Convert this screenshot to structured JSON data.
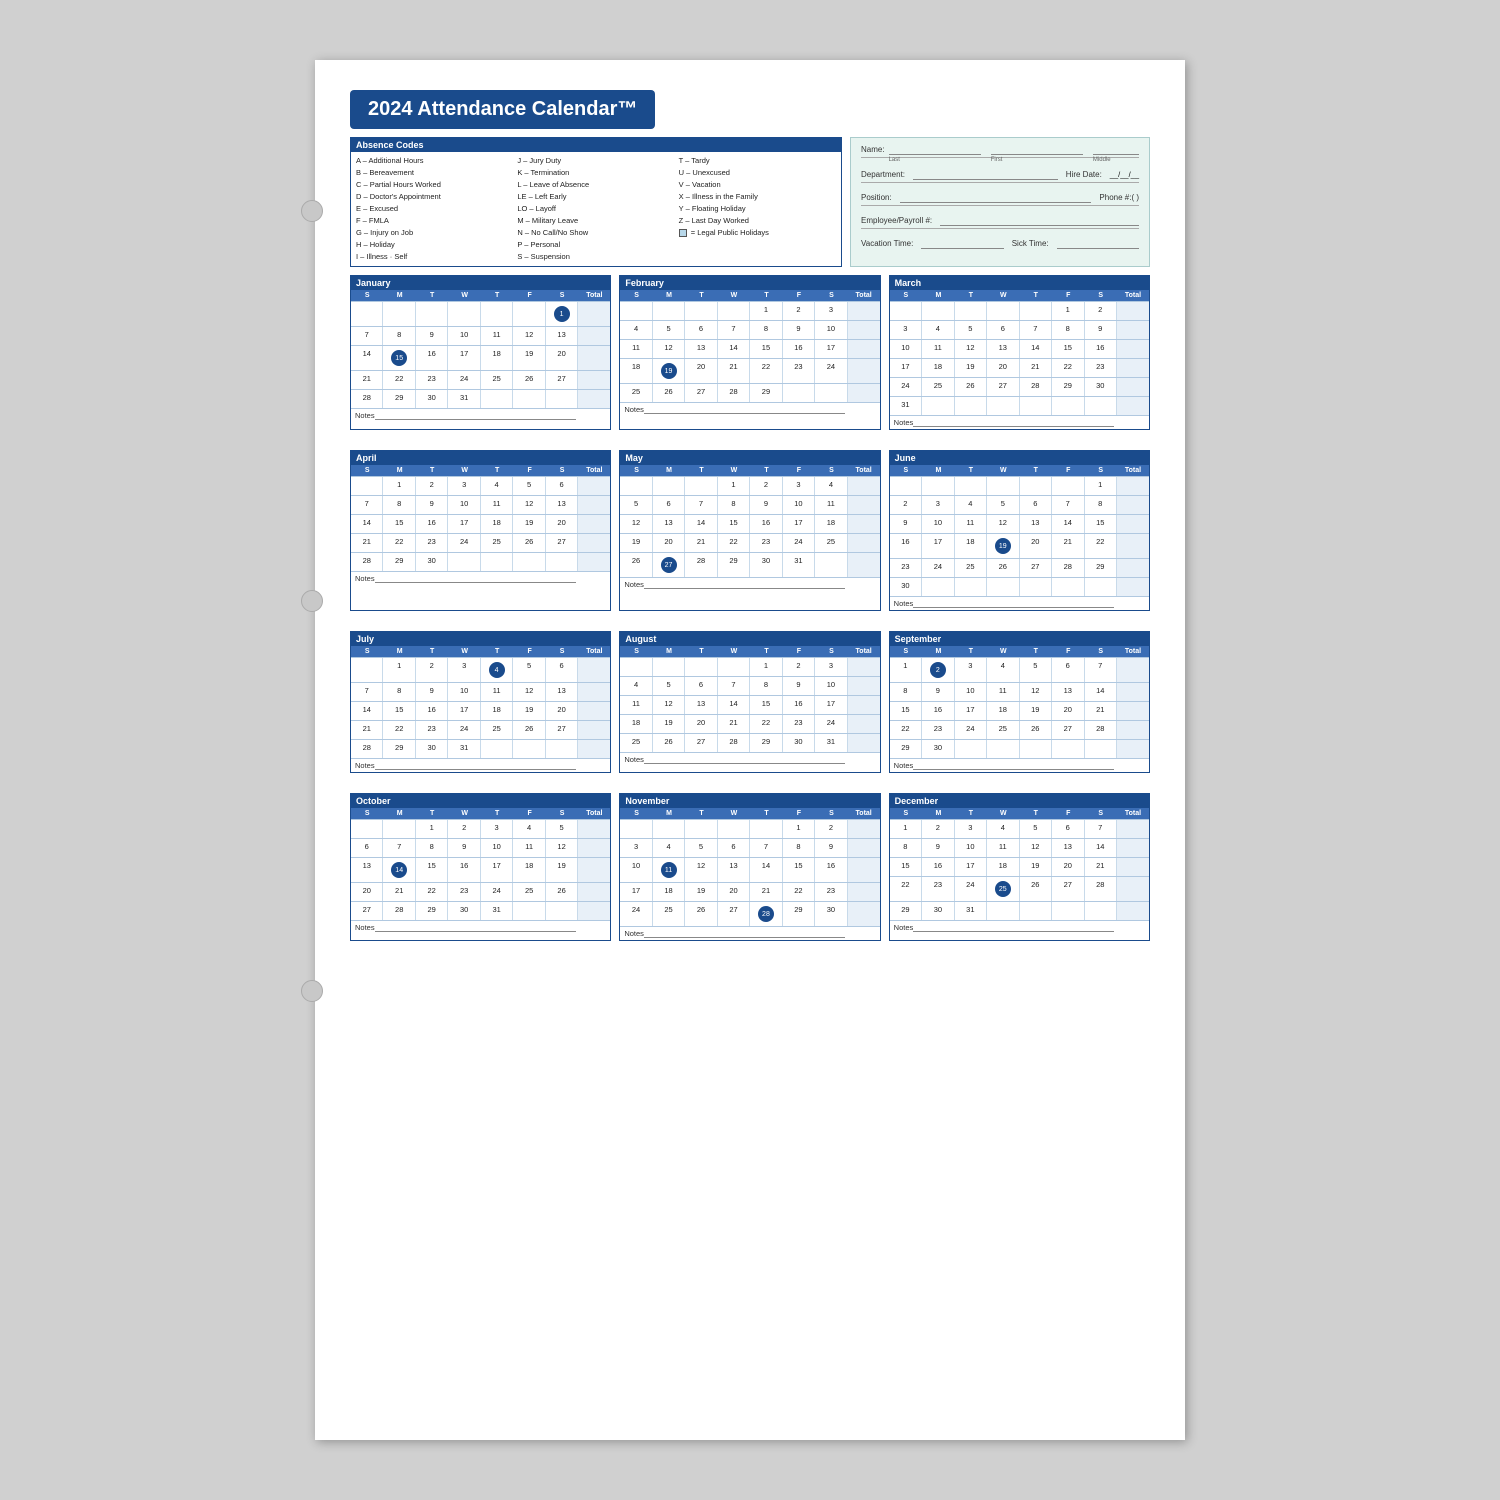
{
  "title": "2024 Attendance Calendar™",
  "absence_codes": {
    "header": "Absence Codes",
    "col1": [
      "A – Additional Hours",
      "B – Bereavement",
      "C – Partial Hours Worked",
      "D – Doctor's Appointment",
      "E – Excused",
      "F – FMLA",
      "G – Injury on Job",
      "H – Holiday",
      "I – Illness · Self"
    ],
    "col2": [
      "J – Jury Duty",
      "K – Termination",
      "L – Leave of Absence",
      "LE – Left Early",
      "LO – Layoff",
      "M – Military Leave",
      "N – No Call/No Show",
      "P – Personal",
      "S – Suspension"
    ],
    "col3": [
      "T – Tardy",
      "U – Unexcused",
      "V – Vacation",
      "X – Illness in the Family",
      "Y – Floating Holiday",
      "Z – Last Day Worked",
      "_",
      "_",
      "= Legal Public Holidays"
    ]
  },
  "info_fields": {
    "name_label": "Name:",
    "name_sub": [
      "Last",
      "First",
      "Middle"
    ],
    "dept_label": "Department:",
    "hire_label": "Hire Date:",
    "position_label": "Position:",
    "phone_label": "Phone #: (     )",
    "emp_payroll_label": "Employee/Payroll #:",
    "vacation_label": "Vacation Time:",
    "sick_label": "Sick Time:"
  },
  "months": [
    {
      "name": "January",
      "days_header": [
        "S",
        "M",
        "T",
        "W",
        "T",
        "F",
        "S",
        "Total"
      ],
      "weeks": [
        [
          "",
          "",
          "",
          "",
          "",
          "",
          "1",
          ""
        ],
        [
          "7",
          "8",
          "9",
          "10",
          "11",
          "12",
          "13",
          ""
        ],
        [
          "14",
          "15",
          "16",
          "17",
          "18",
          "19",
          "20",
          ""
        ],
        [
          "21",
          "22",
          "23",
          "24",
          "25",
          "26",
          "27",
          ""
        ],
        [
          "28",
          "29",
          "30",
          "31",
          "",
          "",
          "",
          ""
        ]
      ],
      "highlights": [
        "1",
        "15"
      ],
      "notes": "Notes_"
    },
    {
      "name": "February",
      "days_header": [
        "S",
        "M",
        "T",
        "W",
        "T",
        "F",
        "S",
        "Total"
      ],
      "weeks": [
        [
          "",
          "",
          "",
          "",
          "1",
          "2",
          "3",
          ""
        ],
        [
          "4",
          "5",
          "6",
          "7",
          "8",
          "9",
          "10",
          ""
        ],
        [
          "11",
          "12",
          "13",
          "14",
          "15",
          "16",
          "17",
          ""
        ],
        [
          "18",
          "19",
          "20",
          "21",
          "22",
          "23",
          "24",
          ""
        ],
        [
          "25",
          "26",
          "27",
          "28",
          "29",
          "",
          "",
          ""
        ]
      ],
      "highlights": [
        "19"
      ],
      "notes": "Notes_"
    },
    {
      "name": "March",
      "days_header": [
        "S",
        "M",
        "T",
        "W",
        "T",
        "F",
        "S",
        "Total"
      ],
      "weeks": [
        [
          "",
          "",
          "",
          "",
          "",
          "1",
          "2",
          ""
        ],
        [
          "3",
          "4",
          "5",
          "6",
          "7",
          "8",
          "9",
          ""
        ],
        [
          "10",
          "11",
          "12",
          "13",
          "14",
          "15",
          "16",
          ""
        ],
        [
          "17",
          "18",
          "19",
          "20",
          "21",
          "22",
          "23",
          ""
        ],
        [
          "24",
          "25",
          "26",
          "27",
          "28",
          "29",
          "30",
          ""
        ],
        [
          "31",
          "",
          "",
          "",
          "",
          "",
          "",
          ""
        ]
      ],
      "highlights": [],
      "notes": "Notes_"
    },
    {
      "name": "April",
      "days_header": [
        "S",
        "M",
        "T",
        "W",
        "T",
        "F",
        "S",
        "Total"
      ],
      "weeks": [
        [
          "",
          "1",
          "2",
          "3",
          "4",
          "5",
          "6",
          ""
        ],
        [
          "7",
          "8",
          "9",
          "10",
          "11",
          "12",
          "13",
          ""
        ],
        [
          "14",
          "15",
          "16",
          "17",
          "18",
          "19",
          "20",
          ""
        ],
        [
          "21",
          "22",
          "23",
          "24",
          "25",
          "26",
          "27",
          ""
        ],
        [
          "28",
          "29",
          "30",
          "",
          "",
          "",
          "",
          ""
        ]
      ],
      "highlights": [],
      "notes": "Notes_"
    },
    {
      "name": "May",
      "days_header": [
        "S",
        "M",
        "T",
        "W",
        "T",
        "F",
        "S",
        "Total"
      ],
      "weeks": [
        [
          "",
          "",
          "",
          "1",
          "2",
          "3",
          "4",
          ""
        ],
        [
          "5",
          "6",
          "7",
          "8",
          "9",
          "10",
          "11",
          ""
        ],
        [
          "12",
          "13",
          "14",
          "15",
          "16",
          "17",
          "18",
          ""
        ],
        [
          "19",
          "20",
          "21",
          "22",
          "23",
          "24",
          "25",
          ""
        ],
        [
          "26",
          "27",
          "28",
          "29",
          "30",
          "31",
          "",
          ""
        ]
      ],
      "highlights": [
        "27"
      ],
      "notes": "Notes_"
    },
    {
      "name": "June",
      "days_header": [
        "S",
        "M",
        "T",
        "W",
        "T",
        "F",
        "S",
        "Total"
      ],
      "weeks": [
        [
          "",
          "",
          "",
          "",
          "",
          "",
          "1",
          ""
        ],
        [
          "2",
          "3",
          "4",
          "5",
          "6",
          "7",
          "8",
          ""
        ],
        [
          "9",
          "10",
          "11",
          "12",
          "13",
          "14",
          "15",
          ""
        ],
        [
          "16",
          "17",
          "18",
          "19",
          "20",
          "21",
          "22",
          ""
        ],
        [
          "23",
          "24",
          "25",
          "26",
          "27",
          "28",
          "29",
          ""
        ],
        [
          "30",
          "",
          "",
          "",
          "",
          "",
          "",
          ""
        ]
      ],
      "highlights": [
        "19"
      ],
      "notes": "Notes_"
    },
    {
      "name": "July",
      "days_header": [
        "S",
        "M",
        "T",
        "W",
        "T",
        "F",
        "S",
        "Total"
      ],
      "weeks": [
        [
          "",
          "1",
          "2",
          "3",
          "4",
          "5",
          "6",
          ""
        ],
        [
          "7",
          "8",
          "9",
          "10",
          "11",
          "12",
          "13",
          ""
        ],
        [
          "14",
          "15",
          "16",
          "17",
          "18",
          "19",
          "20",
          ""
        ],
        [
          "21",
          "22",
          "23",
          "24",
          "25",
          "26",
          "27",
          ""
        ],
        [
          "28",
          "29",
          "30",
          "31",
          "",
          "",
          "",
          ""
        ]
      ],
      "highlights": [
        "4"
      ],
      "notes": "Notes_"
    },
    {
      "name": "August",
      "days_header": [
        "S",
        "M",
        "T",
        "W",
        "T",
        "F",
        "S",
        "Total"
      ],
      "weeks": [
        [
          "",
          "",
          "",
          "",
          "1",
          "2",
          "3",
          ""
        ],
        [
          "4",
          "5",
          "6",
          "7",
          "8",
          "9",
          "10",
          ""
        ],
        [
          "11",
          "12",
          "13",
          "14",
          "15",
          "16",
          "17",
          ""
        ],
        [
          "18",
          "19",
          "20",
          "21",
          "22",
          "23",
          "24",
          ""
        ],
        [
          "25",
          "26",
          "27",
          "28",
          "29",
          "30",
          "31",
          ""
        ]
      ],
      "highlights": [],
      "notes": "Notes_"
    },
    {
      "name": "September",
      "days_header": [
        "S",
        "M",
        "T",
        "W",
        "T",
        "F",
        "S",
        "Total"
      ],
      "weeks": [
        [
          "1",
          "2",
          "3",
          "4",
          "5",
          "6",
          "7",
          ""
        ],
        [
          "8",
          "9",
          "10",
          "11",
          "12",
          "13",
          "14",
          ""
        ],
        [
          "15",
          "16",
          "17",
          "18",
          "19",
          "20",
          "21",
          ""
        ],
        [
          "22",
          "23",
          "24",
          "25",
          "26",
          "27",
          "28",
          ""
        ],
        [
          "29",
          "30",
          "",
          "",
          "",
          "",
          "",
          ""
        ]
      ],
      "highlights": [
        "2"
      ],
      "notes": "Notes_"
    },
    {
      "name": "October",
      "days_header": [
        "S",
        "M",
        "T",
        "W",
        "T",
        "F",
        "S",
        "Total"
      ],
      "weeks": [
        [
          "",
          "",
          "1",
          "2",
          "3",
          "4",
          "5",
          ""
        ],
        [
          "6",
          "7",
          "8",
          "9",
          "10",
          "11",
          "12",
          ""
        ],
        [
          "13",
          "14",
          "15",
          "16",
          "17",
          "18",
          "19",
          ""
        ],
        [
          "20",
          "21",
          "22",
          "23",
          "24",
          "25",
          "26",
          ""
        ],
        [
          "27",
          "28",
          "29",
          "30",
          "31",
          "",
          "",
          ""
        ]
      ],
      "highlights": [
        "14"
      ],
      "notes": "Notes_"
    },
    {
      "name": "November",
      "days_header": [
        "S",
        "M",
        "T",
        "W",
        "T",
        "F",
        "S",
        "Total"
      ],
      "weeks": [
        [
          "",
          "",
          "",
          "",
          "",
          "1",
          "2",
          ""
        ],
        [
          "3",
          "4",
          "5",
          "6",
          "7",
          "8",
          "9",
          ""
        ],
        [
          "10",
          "11",
          "12",
          "13",
          "14",
          "15",
          "16",
          ""
        ],
        [
          "17",
          "18",
          "19",
          "20",
          "21",
          "22",
          "23",
          ""
        ],
        [
          "24",
          "25",
          "26",
          "27",
          "28",
          "29",
          "30",
          ""
        ]
      ],
      "highlights": [
        "11",
        "28"
      ],
      "notes": "Notes_"
    },
    {
      "name": "December",
      "days_header": [
        "S",
        "M",
        "T",
        "W",
        "T",
        "F",
        "S",
        "Total"
      ],
      "weeks": [
        [
          "1",
          "2",
          "3",
          "4",
          "5",
          "6",
          "7",
          ""
        ],
        [
          "8",
          "9",
          "10",
          "11",
          "12",
          "13",
          "14",
          ""
        ],
        [
          "15",
          "16",
          "17",
          "18",
          "19",
          "20",
          "21",
          ""
        ],
        [
          "22",
          "23",
          "24",
          "25",
          "26",
          "27",
          "28",
          ""
        ],
        [
          "29",
          "30",
          "31",
          "",
          "",
          "",
          "",
          ""
        ]
      ],
      "highlights": [
        "25"
      ],
      "notes": "Notes_"
    }
  ]
}
